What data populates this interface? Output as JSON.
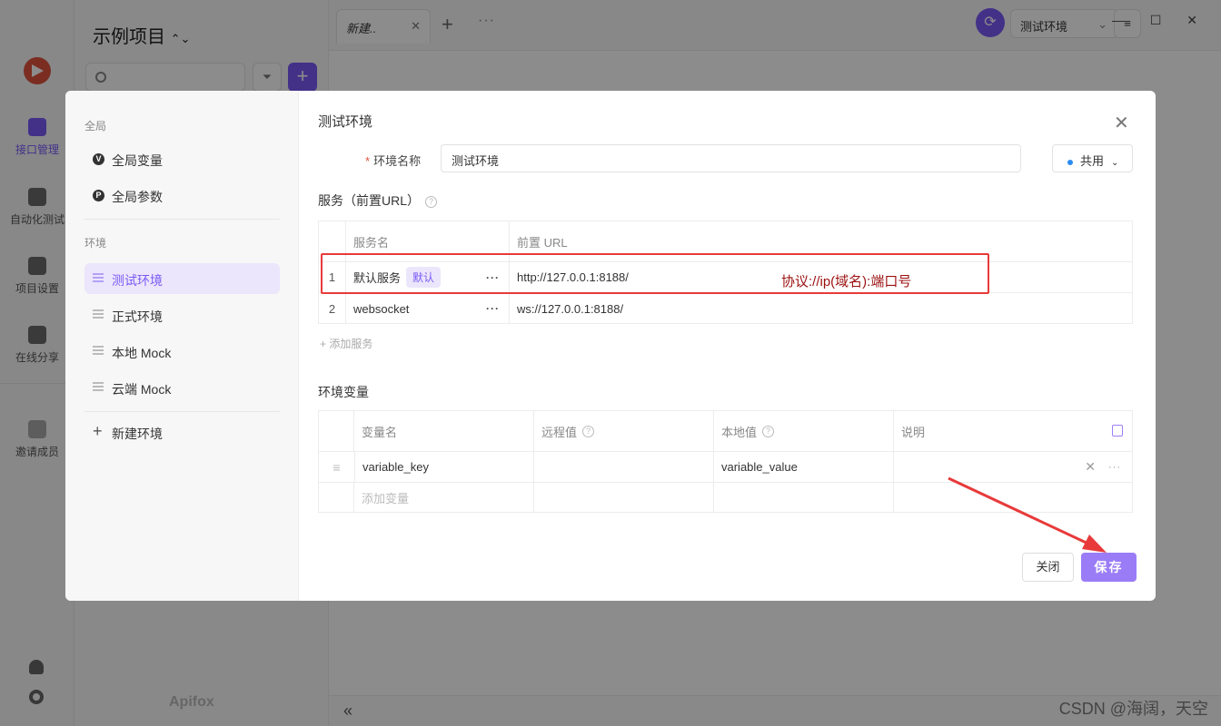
{
  "app": {
    "project_title": "示例项目",
    "project_title_chevron": "⌃⌄",
    "brand": "Apifox",
    "nav": [
      {
        "label": "接口管理"
      },
      {
        "label": "自动化测试"
      },
      {
        "label": "项目设置"
      },
      {
        "label": "在线分享"
      },
      {
        "label": "邀请成员"
      }
    ],
    "tab": {
      "label": "新建..",
      "close": "✕"
    },
    "tab_plus": "+",
    "tab_more": "···",
    "env_select": {
      "value": "测试环境",
      "chevron": "⌄"
    },
    "menu_icon": "≡",
    "window_buttons": "— ☐ ✕",
    "collapse": "«",
    "filter_icon": "⏷",
    "add_icon": "+"
  },
  "modal": {
    "sidebar": {
      "global_group": "全局",
      "global_items": [
        {
          "badge": "V",
          "label": "全局变量"
        },
        {
          "badge": "P",
          "label": "全局参数"
        }
      ],
      "env_group": "环境",
      "env_items": [
        {
          "label": "测试环境",
          "active": true
        },
        {
          "label": "正式环境"
        },
        {
          "label": "本地 Mock"
        },
        {
          "label": "云端 Mock"
        }
      ],
      "new_env": "新建环境",
      "new_env_icon": "+"
    },
    "title": "测试环境",
    "close_icon": "✕",
    "env_name_label": "环境名称",
    "env_name_value": "测试环境",
    "share": {
      "label": "共用",
      "chevron": "⌄"
    },
    "services": {
      "title": "服务（前置URL）",
      "help": "?",
      "headers": [
        "服务名",
        "前置 URL"
      ],
      "rows": [
        {
          "num": "1",
          "name": "默认服务",
          "tag": "默认",
          "more": "···",
          "url": "http://127.0.0.1:8188/"
        },
        {
          "num": "2",
          "name": "websocket",
          "tag": "",
          "more": "···",
          "url": "ws://127.0.0.1:8188/"
        }
      ],
      "add": "+ 添加服务"
    },
    "variables": {
      "title": "环境变量",
      "headers": [
        "变量名",
        "远程值",
        "本地值",
        "说明"
      ],
      "help": "?",
      "rows": [
        {
          "drag": "≡",
          "name": "variable_key",
          "remote": "",
          "local": "variable_value",
          "desc": "",
          "x": "✕",
          "dots": "···"
        }
      ],
      "add_placeholder": "添加变量"
    },
    "buttons": {
      "close": "关闭",
      "save": "保存"
    }
  },
  "annotation": {
    "text": "协议://ip(域名):端口号",
    "box_color": "#e83a3a",
    "arrow_color": "#e83a3a",
    "text_color": "#9b1010"
  },
  "watermark": "CSDN @海阔，天空",
  "colors": {
    "accent": "#7a5af8",
    "save_button": "#9a7cf7",
    "overlay": "rgba(0,0,0,0.45)"
  }
}
